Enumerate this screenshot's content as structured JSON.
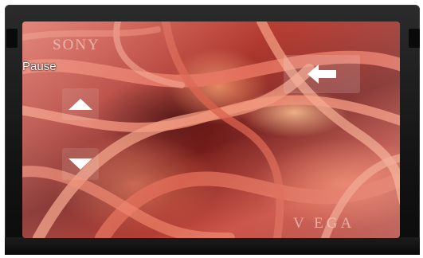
{
  "brand": {
    "top": "SONY",
    "bottom": "V EGA"
  },
  "controls": {
    "pause_label": "Pause",
    "up_icon": "triangle-up-icon",
    "down_icon": "triangle-down-icon",
    "back_icon": "left-arrow-icon"
  },
  "colors": {
    "bezel": "#141414",
    "video_tint": "#c8483b",
    "control_glyph": "#ffffff"
  }
}
